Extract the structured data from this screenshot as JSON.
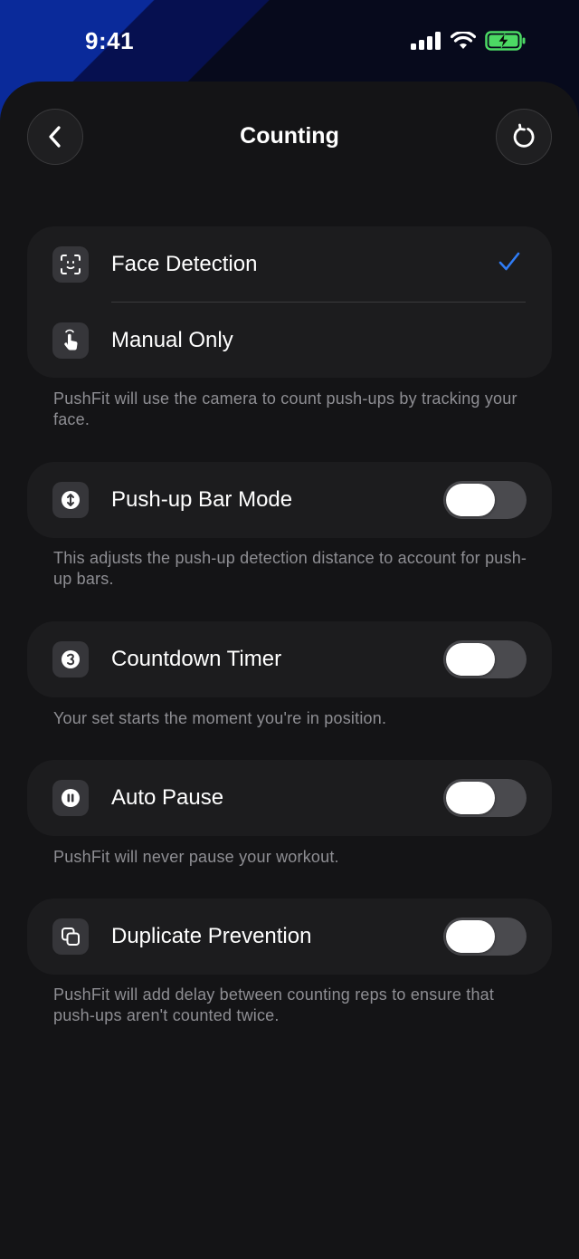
{
  "status_bar": {
    "time": "9:41"
  },
  "header": {
    "title": "Counting"
  },
  "counting_mode": {
    "options": [
      {
        "label": "Face Detection",
        "icon": "face-scan-icon",
        "selected": true
      },
      {
        "label": "Manual Only",
        "icon": "hand-tap-icon",
        "selected": false
      }
    ],
    "footnote": "PushFit will use the camera to count push-ups by tracking your face."
  },
  "settings": [
    {
      "label": "Push-up Bar Mode",
      "icon": "vertical-arrows-icon",
      "enabled": false,
      "footnote": "This adjusts the push-up detection distance to account for push-up bars."
    },
    {
      "label": "Countdown Timer",
      "icon": "number-3-icon",
      "enabled": false,
      "footnote": "Your set starts the moment you're in position."
    },
    {
      "label": "Auto Pause",
      "icon": "pause-icon",
      "enabled": false,
      "footnote": "PushFit will never pause your workout."
    },
    {
      "label": "Duplicate Prevention",
      "icon": "duplicate-icon",
      "enabled": false,
      "footnote": "PushFit will add delay between counting reps to ensure that push-ups aren't counted twice."
    }
  ],
  "colors": {
    "accent": "#2f7cf6",
    "battery": "#4cd964",
    "background": "#141416",
    "card": "#1c1c1e"
  }
}
